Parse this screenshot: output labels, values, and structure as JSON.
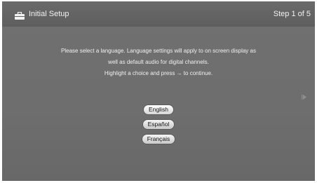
{
  "header": {
    "title": "Initial Setup",
    "step": "Step 1 of 5",
    "icon": "toolbox-icon"
  },
  "message": {
    "line1": "Please select a language. Language settings will apply to on screen display as",
    "line2": "well as default audio for digital channels.",
    "line3": "Highlight a choice and press → to continue."
  },
  "languages": [
    {
      "label": "English",
      "selected": true
    },
    {
      "label": "Español",
      "selected": false
    },
    {
      "label": "Français",
      "selected": false
    }
  ],
  "colors": {
    "background": "#6e6e6e",
    "header": "#626262",
    "text": "#f0f0f0",
    "button": "#e6e6e6"
  }
}
